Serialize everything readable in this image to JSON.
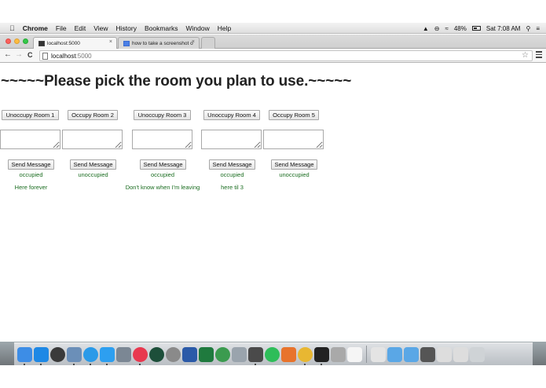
{
  "menubar": {
    "app_name": "Chrome",
    "items": [
      "File",
      "Edit",
      "View",
      "History",
      "Bookmarks",
      "Window",
      "Help"
    ],
    "battery_percent": "48%",
    "clock": "Sat 7:08 AM"
  },
  "tabs": [
    {
      "title": "localhost:5000",
      "close": "×"
    },
    {
      "title": "how to take a screenshot o",
      "close": "×"
    }
  ],
  "toolbar": {
    "back": "←",
    "forward": "→",
    "reload": "C",
    "url_host": "localhost",
    "url_port": ":5000",
    "bookmark_star": "☆"
  },
  "page": {
    "heading": "~~~~~Please pick the room you plan to use.~~~~~",
    "rooms": [
      {
        "action_label": "Unoccupy Room 1",
        "send_label": "Send Message",
        "status": "occupied",
        "message": "Here forever",
        "input_value": ""
      },
      {
        "action_label": "Occupy Room 2",
        "send_label": "Send Message",
        "status": "unoccupied",
        "message": "",
        "input_value": ""
      },
      {
        "action_label": "Unoccupy Room 3",
        "send_label": "Send Message",
        "status": "occupied",
        "message": "Don't know when I'm leaving",
        "input_value": ""
      },
      {
        "action_label": "Unoccupy Room 4",
        "send_label": "Send Message",
        "status": "occupied",
        "message": "here til 3",
        "input_value": ""
      },
      {
        "action_label": "Occupy Room 5",
        "send_label": "Send Message",
        "status": "unoccupied",
        "message": "",
        "input_value": ""
      }
    ]
  },
  "colors": {
    "status_green": "#196c1f",
    "heading": "#222222"
  },
  "dock": {
    "apps": [
      {
        "name": "finder-icon",
        "color": "#3d8de6"
      },
      {
        "name": "app-store-icon",
        "color": "#1e88e5"
      },
      {
        "name": "dashboard-icon",
        "color": "#3a3a3a"
      },
      {
        "name": "preview-icon",
        "color": "#6b8fb8"
      },
      {
        "name": "safari-icon",
        "color": "#2a9ae8"
      },
      {
        "name": "messages-icon",
        "color": "#2d9ff0"
      },
      {
        "name": "photo-browser-icon",
        "color": "#7b8794"
      },
      {
        "name": "itunes-icon",
        "color": "#e8384f"
      },
      {
        "name": "time-machine-icon",
        "color": "#1d4f3a"
      },
      {
        "name": "system-preferences-icon",
        "color": "#8a8a8a"
      },
      {
        "name": "word-icon",
        "color": "#2b5aa8"
      },
      {
        "name": "excel-icon",
        "color": "#1f7a3e"
      },
      {
        "name": "globe-icon",
        "color": "#3b9b4f"
      },
      {
        "name": "image-capture-icon",
        "color": "#9aa4ad"
      },
      {
        "name": "sublime-icon",
        "color": "#4a4a4a"
      },
      {
        "name": "spotify-icon",
        "color": "#2ebd59"
      },
      {
        "name": "firefox-icon",
        "color": "#e8732c"
      },
      {
        "name": "chrome-icon",
        "color": "#e8b732"
      },
      {
        "name": "terminal-icon",
        "color": "#222222"
      },
      {
        "name": "script-editor-icon",
        "color": "#a9a9a9"
      },
      {
        "name": "document-icon",
        "color": "#f5f5f5"
      },
      {
        "name": "separator"
      },
      {
        "name": "applications-folder-icon",
        "color": "#e4e4e4"
      },
      {
        "name": "folder-icon",
        "color": "#5aa7e6"
      },
      {
        "name": "downloads-folder-icon",
        "color": "#5aa7e6"
      },
      {
        "name": "minimized-window-icon",
        "color": "#555555"
      },
      {
        "name": "minimized-window-icon-2",
        "color": "#dddddd"
      },
      {
        "name": "minimized-window-icon-3",
        "color": "#dddddd"
      },
      {
        "name": "trash-icon",
        "color": "#cfd3d6"
      }
    ],
    "running": [
      0,
      1,
      3,
      4,
      5,
      7,
      14,
      17,
      18
    ]
  }
}
